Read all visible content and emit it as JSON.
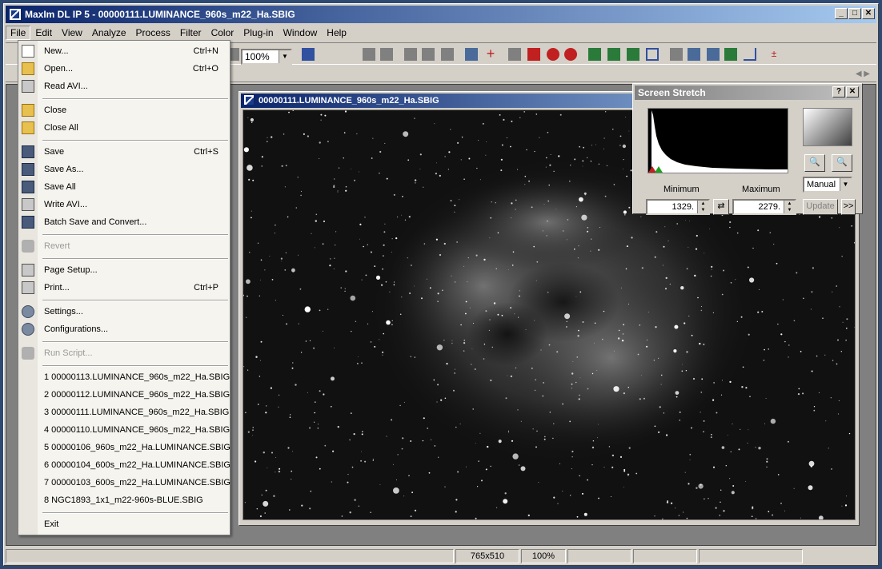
{
  "window": {
    "title": "MaxIm DL IP 5 - 00000111.LUMINANCE_960s_m22_Ha.SBIG",
    "minimize": "_",
    "maximize": "□",
    "close": "✕"
  },
  "menubar": [
    "File",
    "Edit",
    "View",
    "Analyze",
    "Process",
    "Filter",
    "Color",
    "Plug-in",
    "Window",
    "Help"
  ],
  "toolbar": {
    "zoom": "100%"
  },
  "file_menu": {
    "items": [
      {
        "label": "New...",
        "shortcut": "Ctrl+N",
        "icon": "new-document-icon"
      },
      {
        "label": "Open...",
        "shortcut": "Ctrl+O",
        "icon": "open-folder-icon"
      },
      {
        "label": "Read AVI...",
        "shortcut": "",
        "icon": "read-avi-icon"
      },
      {
        "label": "Close",
        "shortcut": "",
        "icon": "close-folder-icon"
      },
      {
        "label": "Close All",
        "shortcut": "",
        "icon": "close-all-icon"
      },
      {
        "label": "Save",
        "shortcut": "Ctrl+S",
        "icon": "save-disk-icon"
      },
      {
        "label": "Save As...",
        "shortcut": "",
        "icon": "save-as-icon"
      },
      {
        "label": "Save All",
        "shortcut": "",
        "icon": "save-all-icon"
      },
      {
        "label": "Write AVI...",
        "shortcut": "",
        "icon": "write-avi-icon"
      },
      {
        "label": "Batch Save and Convert...",
        "shortcut": "",
        "icon": "batch-save-icon"
      },
      {
        "label": "Revert",
        "shortcut": "",
        "icon": "revert-icon"
      },
      {
        "label": "Page Setup...",
        "shortcut": "",
        "icon": "page-setup-icon"
      },
      {
        "label": "Print...",
        "shortcut": "Ctrl+P",
        "icon": "printer-icon"
      },
      {
        "label": "Settings...",
        "shortcut": "",
        "icon": "settings-icon"
      },
      {
        "label": "Configurations...",
        "shortcut": "",
        "icon": "configurations-icon"
      },
      {
        "label": "Run Script...",
        "shortcut": "",
        "icon": "run-script-icon"
      }
    ],
    "recent": [
      "1 00000113.LUMINANCE_960s_m22_Ha.SBIG",
      "2 00000112.LUMINANCE_960s_m22_Ha.SBIG",
      "3 00000111.LUMINANCE_960s_m22_Ha.SBIG",
      "4 00000110.LUMINANCE_960s_m22_Ha.SBIG",
      "5 00000106_960s_m22_Ha.LUMINANCE.SBIG",
      "6 00000104_600s_m22_Ha.LUMINANCE.SBIG",
      "7 00000103_600s_m22_Ha.LUMINANCE.SBIG",
      "8 NGC1893_1x1_m22-960s-BLUE.SBIG"
    ],
    "exit": "Exit"
  },
  "document": {
    "title": "00000111.LUMINANCE_960s_m22_Ha.SBIG"
  },
  "screen_stretch": {
    "title": "Screen Stretch",
    "help": "?",
    "close": "✕",
    "minimum_label": "Minimum",
    "maximum_label": "Maximum",
    "minimum_value": "1329.",
    "maximum_value": "2279.",
    "mode": "Manual",
    "update": "Update",
    "expand": ">>"
  },
  "status": {
    "dimensions": "765x510",
    "zoom": "100%"
  }
}
